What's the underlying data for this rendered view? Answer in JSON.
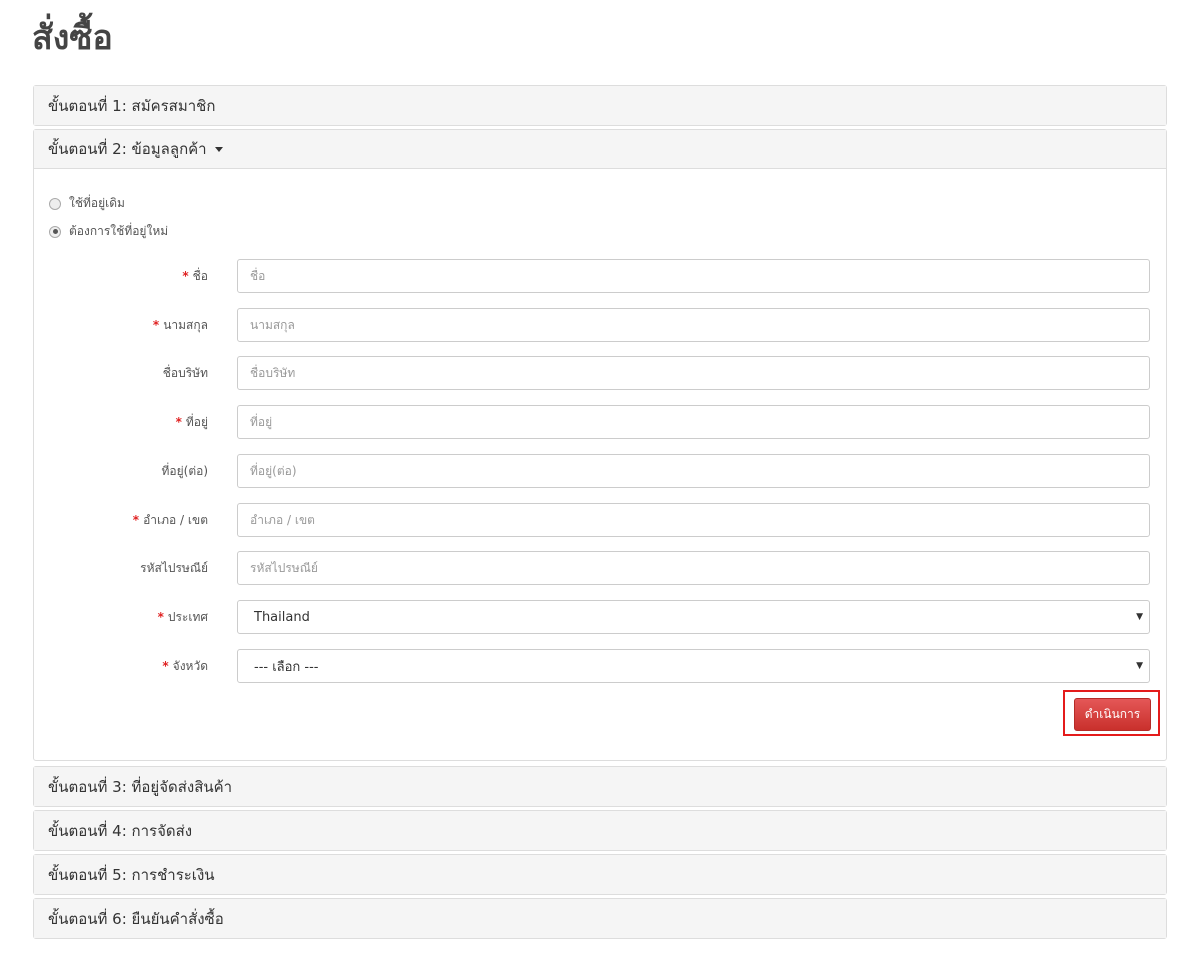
{
  "page_title": "สั่งซื้อ",
  "steps": [
    {
      "label": "ขั้นตอนที่ 1: สมัครสมาชิก"
    },
    {
      "label": "ขั้นตอนที่ 2: ข้อมูลลูกค้า"
    },
    {
      "label": "ขั้นตอนที่ 3: ที่อยู่จัดส่งสินค้า"
    },
    {
      "label": "ขั้นตอนที่ 4: การจัดส่ง"
    },
    {
      "label": "ขั้นตอนที่ 5: การชำระเงิน"
    },
    {
      "label": "ขั้นตอนที่ 6: ยืนยันคำสั่งซื้อ"
    }
  ],
  "address_options": {
    "existing": "ใช้ที่อยู่เดิม",
    "new": "ต้องการใช้ที่อยู่ใหม่",
    "selected": "new"
  },
  "required_mark": "*",
  "fields": {
    "firstname": {
      "label": "ชื่อ",
      "placeholder": "ชื่อ",
      "required": true
    },
    "lastname": {
      "label": "นามสกุล",
      "placeholder": "นามสกุล",
      "required": true
    },
    "company": {
      "label": "ชื่อบริษัท",
      "placeholder": "ชื่อบริษัท",
      "required": false
    },
    "address1": {
      "label": "ที่อยู่",
      "placeholder": "ที่อยู่",
      "required": true
    },
    "address2": {
      "label": "ที่อยู่(ต่อ)",
      "placeholder": "ที่อยู่(ต่อ)",
      "required": false
    },
    "district": {
      "label": "อำเภอ / เขต",
      "placeholder": "อำเภอ / เขต",
      "required": true
    },
    "postcode": {
      "label": "รหัสไปรษณีย์",
      "placeholder": "รหัสไปรษณีย์",
      "required": false
    },
    "country": {
      "label": "ประเทศ",
      "value": "Thailand",
      "required": true
    },
    "province": {
      "label": "จังหวัด",
      "value": "--- เลือก ---",
      "required": true
    }
  },
  "continue_button": "ดำเนินการ",
  "colors": {
    "required": "#e02222",
    "button": "#d9534f",
    "highlight": "#e41b1b",
    "panel_heading": "#f5f5f5"
  }
}
